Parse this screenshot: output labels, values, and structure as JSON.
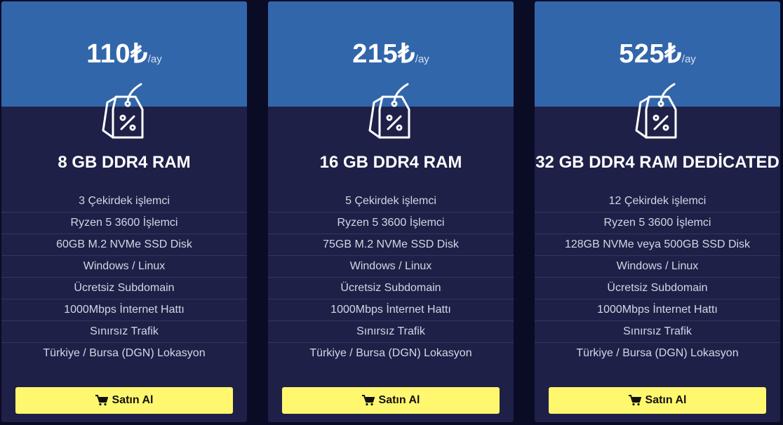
{
  "plans": [
    {
      "price": "110₺",
      "period": "/ay",
      "icon": "discount-tag-icon",
      "title": "8 GB DDR4 RAM",
      "features": [
        "3 Çekirdek işlemci",
        "Ryzen 5 3600 İşlemci",
        "60GB M.2 NVMe SSD Disk",
        "Windows / Linux",
        "Ücretsiz Subdomain",
        "1000Mbps İnternet Hattı",
        "Sınırsız Trafik",
        "Türkiye / Bursa (DGN) Lokasyon"
      ],
      "button_label": "Satın Al",
      "button_icon": "cart-icon"
    },
    {
      "price": "215₺",
      "period": "/ay",
      "icon": "discount-tag-icon",
      "title": "16 GB DDR4 RAM",
      "features": [
        "5 Çekirdek işlemci",
        "Ryzen 5 3600 İşlemci",
        "75GB M.2 NVMe SSD Disk",
        "Windows / Linux",
        "Ücretsiz Subdomain",
        "1000Mbps İnternet Hattı",
        "Sınırsız Trafik",
        "Türkiye / Bursa (DGN) Lokasyon"
      ],
      "button_label": "Satın Al",
      "button_icon": "cart-icon"
    },
    {
      "price": "525₺",
      "period": "/ay",
      "icon": "discount-tag-icon",
      "title": "32 GB DDR4 RAM DEDİCATED",
      "features": [
        "12 Çekirdek işlemci",
        "Ryzen 5 3600 İşlemci",
        "128GB NVMe veya 500GB SSD Disk",
        "Windows / Linux",
        "Ücretsiz Subdomain",
        "1000Mbps İnternet Hattı",
        "Sınırsız Trafik",
        "Türkiye / Bursa (DGN) Lokasyon"
      ],
      "button_label": "Satın Al",
      "button_icon": "cart-icon"
    }
  ],
  "colors": {
    "page_background": "#0a0b24",
    "card_background": "#1e2047",
    "header_background": "#3266aa",
    "button_background": "#fff76e"
  }
}
